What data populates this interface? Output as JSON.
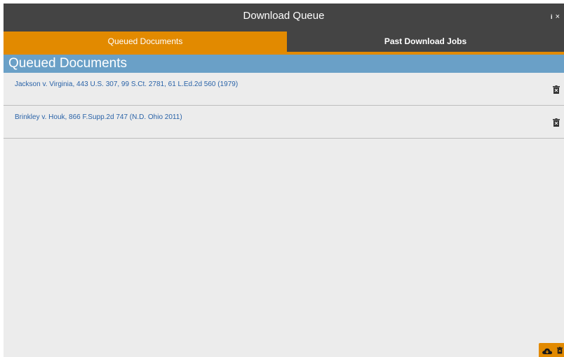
{
  "window": {
    "title": "Download Queue",
    "info_label": "i",
    "close_label": "×"
  },
  "tabs": [
    {
      "label": "Queued Documents",
      "active": true
    },
    {
      "label": "Past Download Jobs",
      "active": false
    }
  ],
  "section": {
    "title": "Queued Documents"
  },
  "documents": [
    {
      "citation": "Jackson v. Virginia, 443 U.S. 307, 99 S.Ct. 2781, 61 L.Ed.2d 560 (1979)"
    },
    {
      "citation": "Brinkley v. Houk, 866 F.Supp.2d 747 (N.D. Ohio 2011)"
    }
  ],
  "icons": {
    "trash": "trash-icon",
    "download": "cloud-download-icon",
    "delete_all": "trash-icon"
  },
  "colors": {
    "accent": "#e28a00",
    "titlebar": "#444444",
    "section_header": "#6aa0c7",
    "link": "#2a63a8",
    "background": "#ececec"
  }
}
